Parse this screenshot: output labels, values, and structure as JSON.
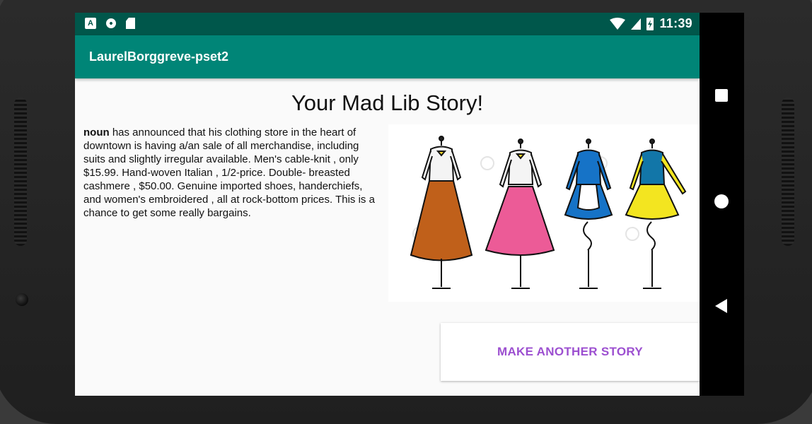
{
  "status_bar": {
    "time": "11:39",
    "left_icons": [
      "a-notification-icon",
      "circle-notification-icon",
      "sd-card-icon"
    ],
    "right_icons": [
      "wifi-icon",
      "signal-icon",
      "battery-charging-icon"
    ]
  },
  "app_bar": {
    "title": "LaurelBorggreve-pset2"
  },
  "main": {
    "heading": "Your Mad Lib Story!",
    "story_bold": "noun",
    "story_text": " has announced that his clothing store in the heart of downtown is having a/an sale of all merchandise, including suits and slightly irregular available. Men's cable-knit , only $15.99. Hand-woven Italian , 1/2-price. Double- breasted cashmere , $50.00. Genuine imported shoes, handerchiefs, and women's embroidered , all at rock-bottom prices. This is a chance to get some really bargains.",
    "button_label": "MAKE ANOTHER STORY"
  },
  "nav_bar": [
    "recents-square-icon",
    "home-circle-icon",
    "back-triangle-icon"
  ],
  "colors": {
    "status_bar": "#00574b",
    "app_bar": "#008577",
    "button_text": "#9c4fd0"
  }
}
